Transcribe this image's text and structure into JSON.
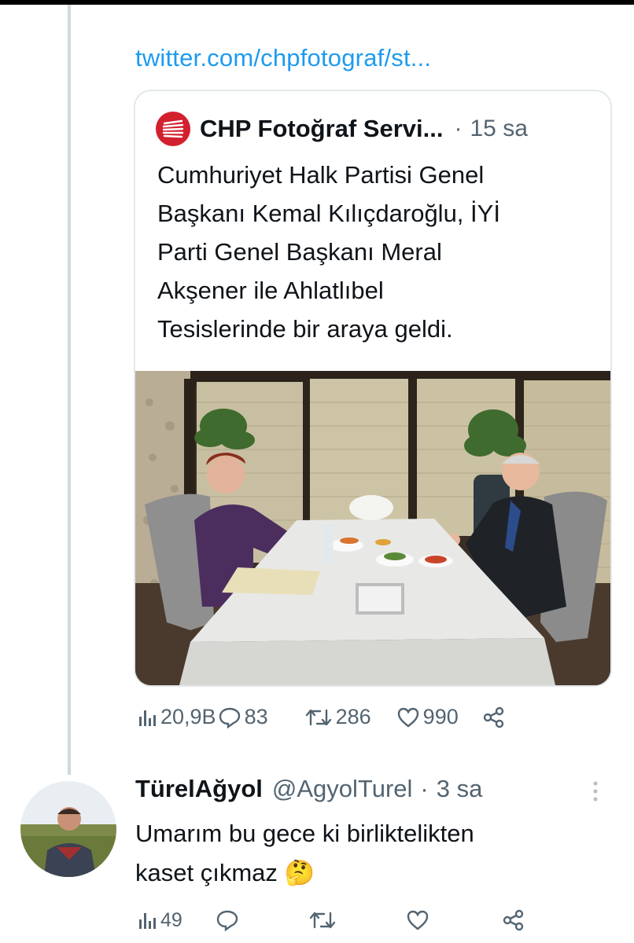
{
  "link_preview": {
    "url_text": "twitter.com/chpfotograf/st..."
  },
  "quoted_tweet": {
    "author_name": "CHP Fotoğraf Servi...",
    "separator": "·",
    "time": "15 sa",
    "avatar_icon": "chp-six-arrows-logo",
    "text_lines": [
      "Cumhuriyet Halk Partisi Genel",
      "Başkanı Kemal Kılıçdaroğlu, İYİ",
      "Parti Genel Başkanı Meral",
      "Akşener ile Ahlatlıbel",
      "Tesislerinde bir araya geldi."
    ],
    "photo_icon": "dinner-meeting-photo"
  },
  "tweet_actions": {
    "views": "20,9B",
    "replies": "83",
    "retweets": "286",
    "likes": "990"
  },
  "reply": {
    "display_name": "TürelAğyol",
    "handle": "@AgyolTurel",
    "separator": "·",
    "time": "3 sa",
    "text_line1": "Umarım bu gece ki birliktelikten",
    "text_line2": "kaset çıkmaz",
    "emoji": "🤔",
    "actions": {
      "views": "49"
    }
  },
  "colors": {
    "accent": "#1d9bf0",
    "muted": "#536471",
    "text": "#0f1419",
    "chp_red": "#d3202f",
    "border": "#e3e8eb"
  }
}
